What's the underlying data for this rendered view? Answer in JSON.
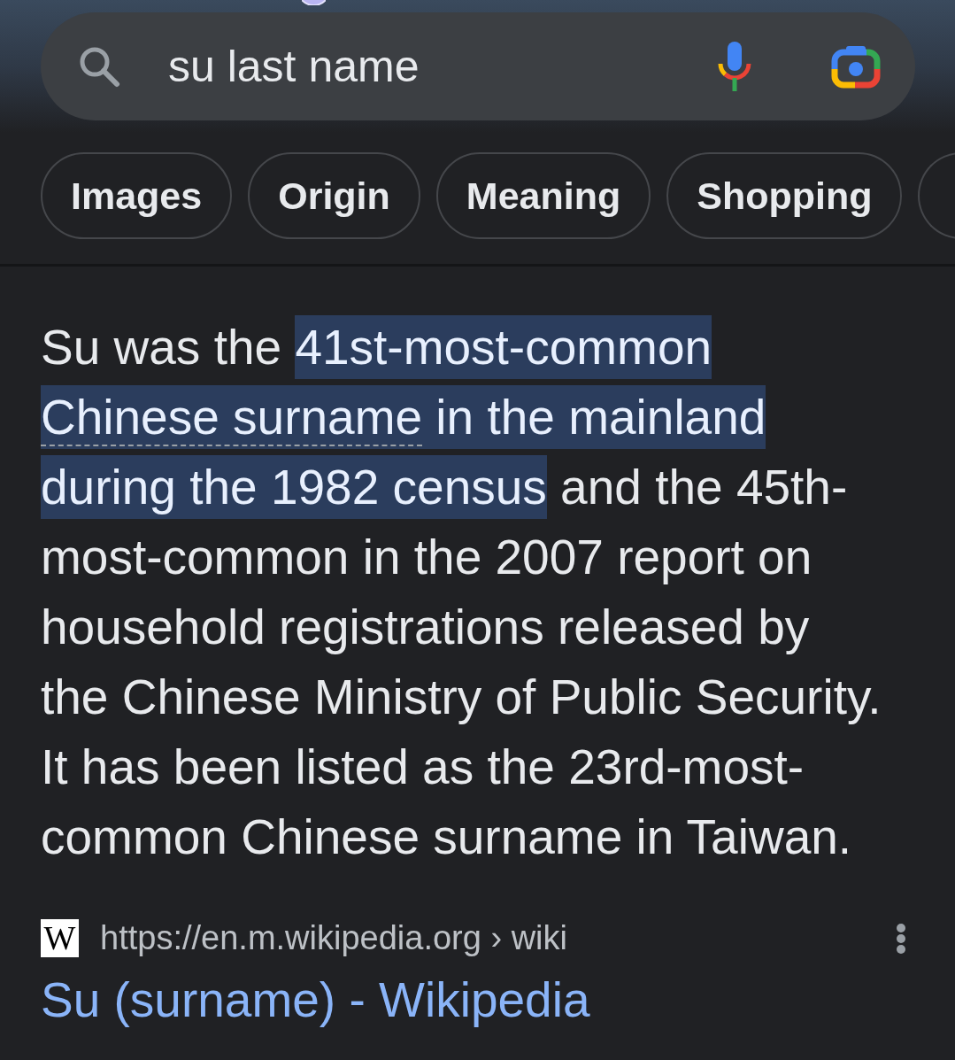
{
  "search": {
    "query": "su last name"
  },
  "chips": [
    {
      "label": "Images",
      "partial": false
    },
    {
      "label": "Origin",
      "partial": false
    },
    {
      "label": "Meaning",
      "partial": false
    },
    {
      "label": "Shopping",
      "partial": false
    },
    {
      "partial": true
    }
  ],
  "snippet": {
    "segments": [
      {
        "text": "Su was the ",
        "highlighted": false,
        "underlined": false
      },
      {
        "text": "41st-most-common ",
        "highlighted": true,
        "underlined": false
      },
      {
        "text": "Chinese surname",
        "highlighted": true,
        "underlined": true
      },
      {
        "text": " in the mainland during the 1982 census",
        "highlighted": true,
        "underlined": false
      },
      {
        "text": " and the 45th-most-common in the 2007 report on household registrations released by the Chinese Ministry of Public Security. It has been listed as the 23rd-most-common Chinese surname in Taiwan.",
        "highlighted": false,
        "underlined": false
      }
    ]
  },
  "source": {
    "favicon": "W",
    "url": "https://en.m.wikipedia.org › wiki",
    "title": "Su (surname) - Wikipedia"
  }
}
